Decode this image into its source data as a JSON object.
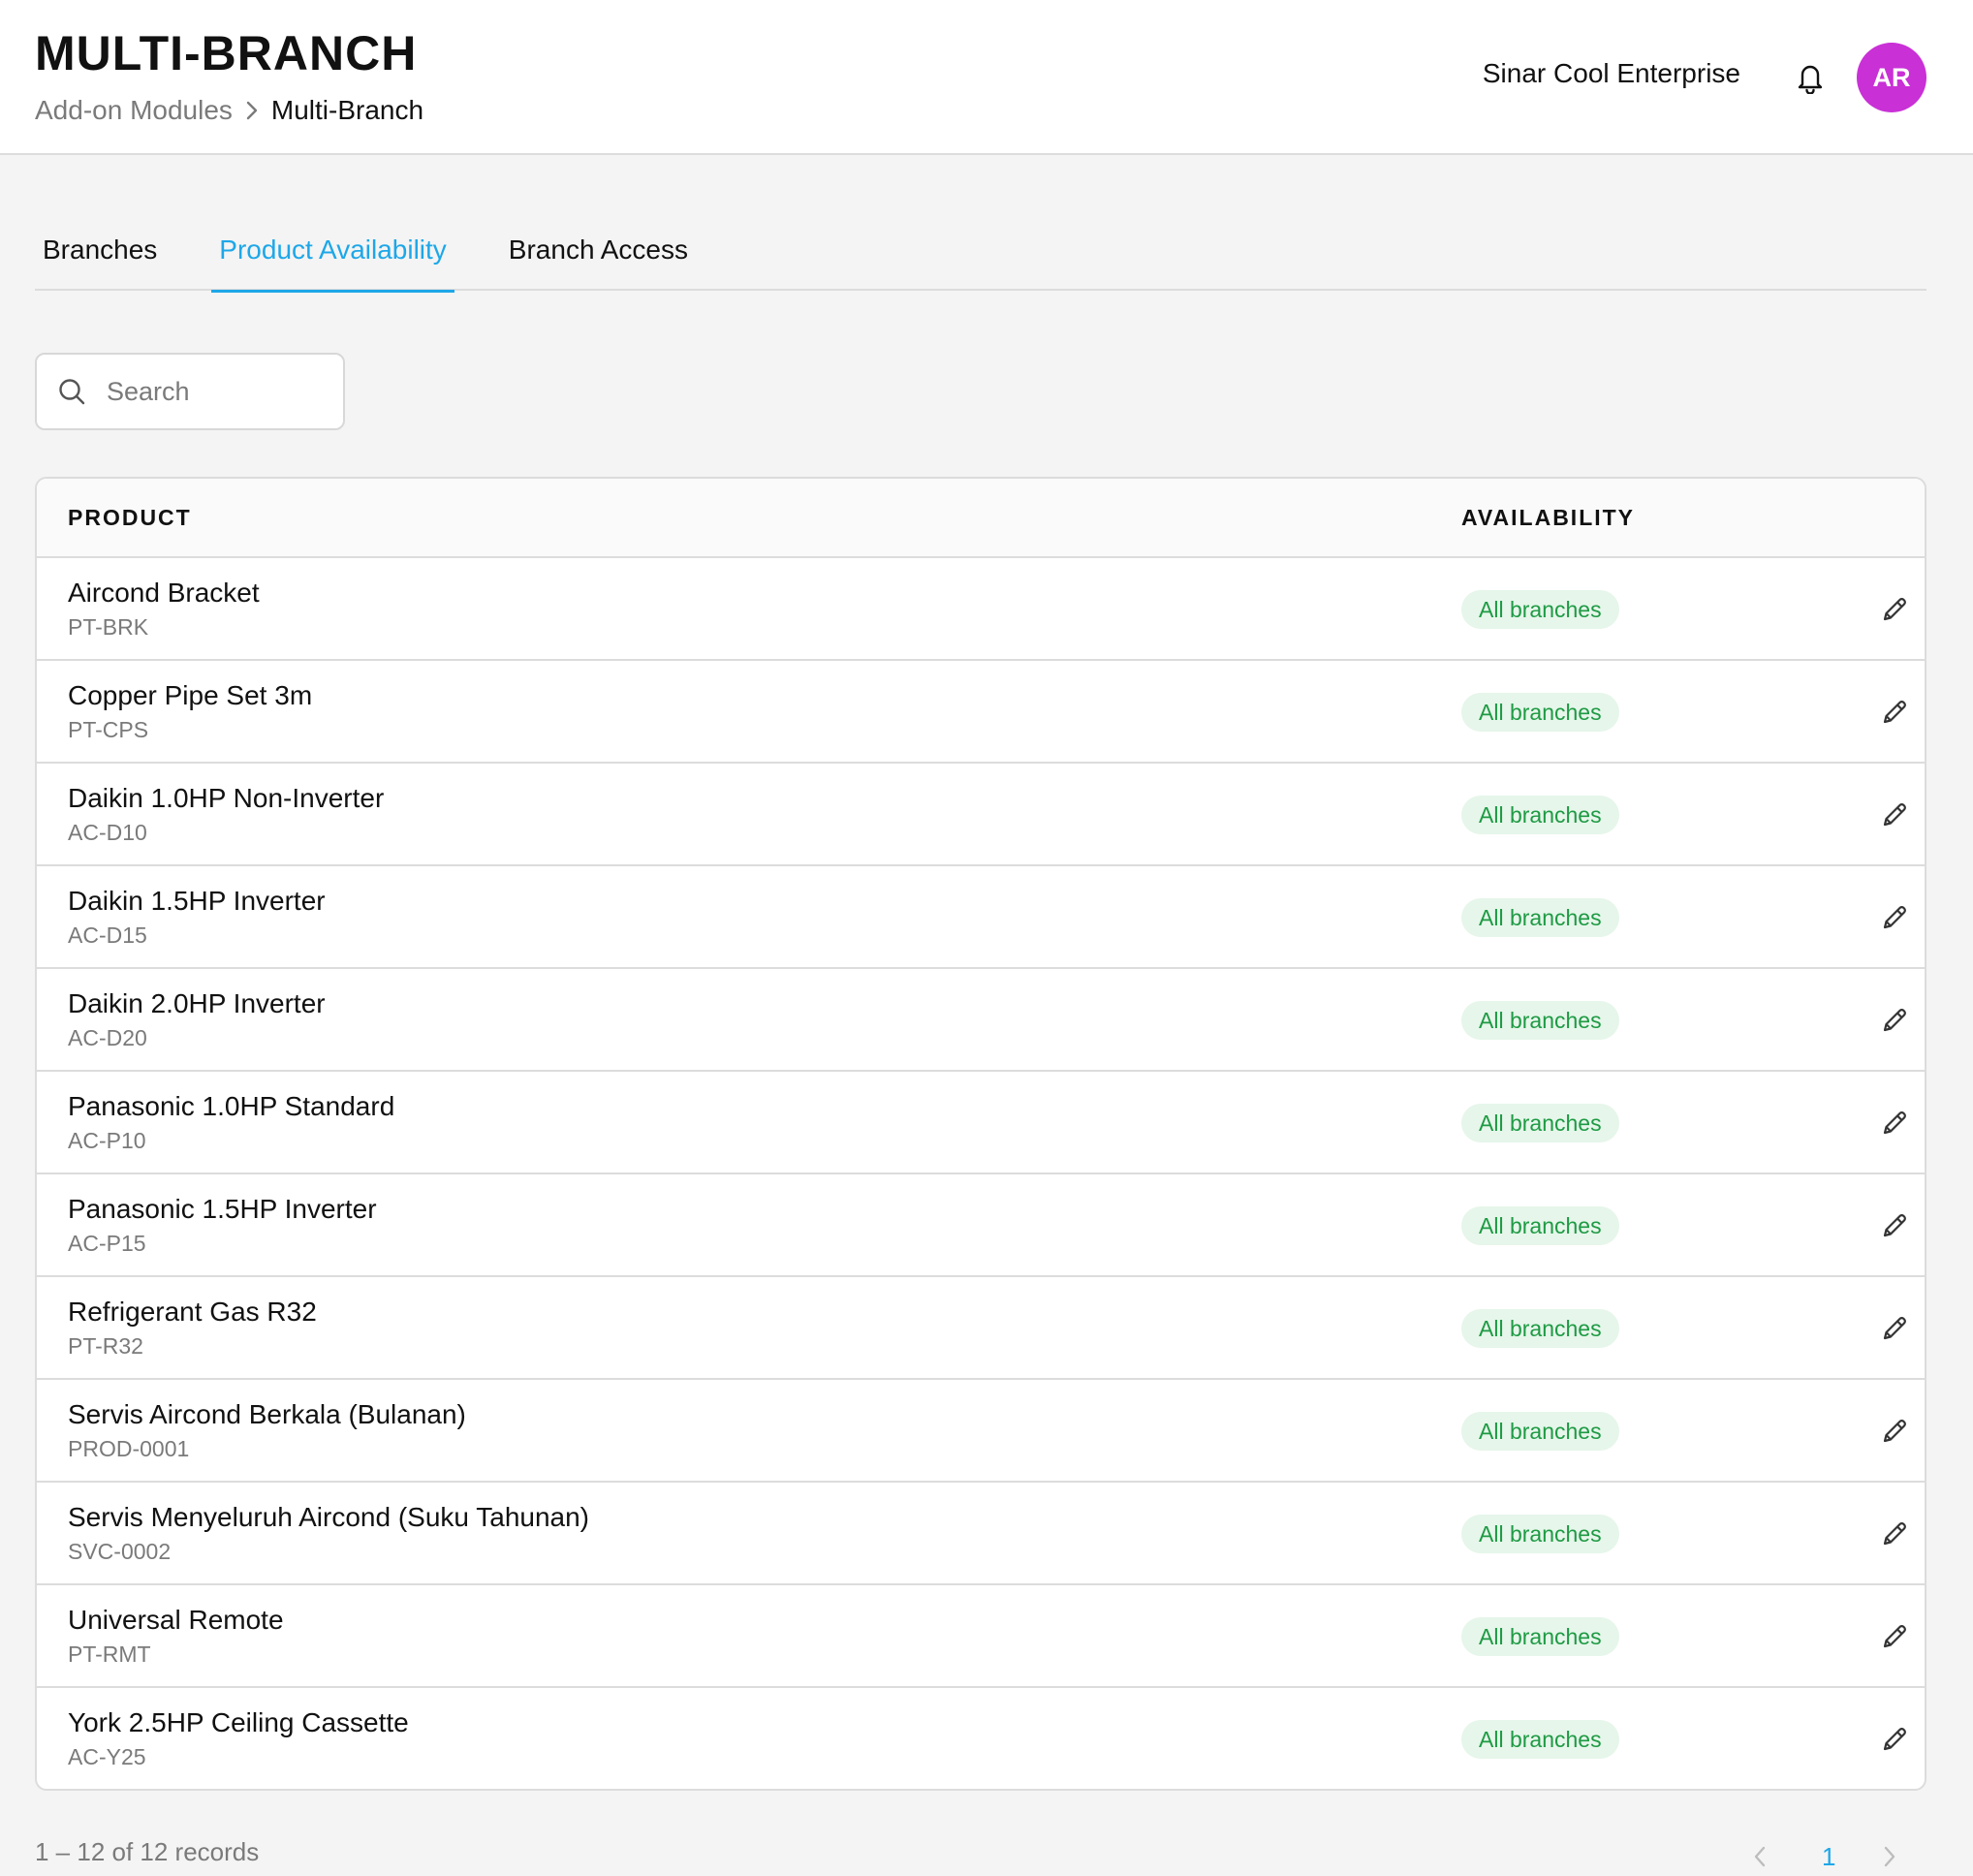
{
  "header": {
    "title": "MULTI-BRANCH",
    "breadcrumb": {
      "parent": "Add-on Modules",
      "current": "Multi-Branch"
    },
    "company": "Sinar Cool Enterprise",
    "avatar_initials": "AR",
    "avatar_color": "#c930d6",
    "icons": {
      "notifications": "bell-icon",
      "breadcrumb_separator": "chevron-right-icon"
    }
  },
  "tabs": [
    {
      "label": "Branches",
      "active": false
    },
    {
      "label": "Product Availability",
      "active": true
    },
    {
      "label": "Branch Access",
      "active": false
    }
  ],
  "search": {
    "placeholder": "Search",
    "value": ""
  },
  "table": {
    "columns": {
      "product": "PRODUCT",
      "availability": "AVAILABILITY"
    },
    "rows": [
      {
        "name": "Aircond Bracket",
        "code": "PT-BRK",
        "availability": "All branches"
      },
      {
        "name": "Copper Pipe Set 3m",
        "code": "PT-CPS",
        "availability": "All branches"
      },
      {
        "name": "Daikin 1.0HP Non-Inverter",
        "code": "AC-D10",
        "availability": "All branches"
      },
      {
        "name": "Daikin 1.5HP Inverter",
        "code": "AC-D15",
        "availability": "All branches"
      },
      {
        "name": "Daikin 2.0HP Inverter",
        "code": "AC-D20",
        "availability": "All branches"
      },
      {
        "name": "Panasonic 1.0HP Standard",
        "code": "AC-P10",
        "availability": "All branches"
      },
      {
        "name": "Panasonic 1.5HP Inverter",
        "code": "AC-P15",
        "availability": "All branches"
      },
      {
        "name": "Refrigerant Gas R32",
        "code": "PT-R32",
        "availability": "All branches"
      },
      {
        "name": "Servis Aircond Berkala (Bulanan)",
        "code": "PROD-0001",
        "availability": "All branches"
      },
      {
        "name": "Servis Menyeluruh Aircond (Suku Tahunan)",
        "code": "SVC-0002",
        "availability": "All branches"
      },
      {
        "name": "Universal Remote",
        "code": "PT-RMT",
        "availability": "All branches"
      },
      {
        "name": "York 2.5HP Ceiling Cassette",
        "code": "AC-Y25",
        "availability": "All branches"
      }
    ]
  },
  "footer": {
    "records_text": "1 – 12 of 12 records",
    "current_page": "1"
  },
  "colors": {
    "accent": "#1ea7e8",
    "badge_bg": "#e6f6ea",
    "badge_text": "#1e9a44"
  }
}
